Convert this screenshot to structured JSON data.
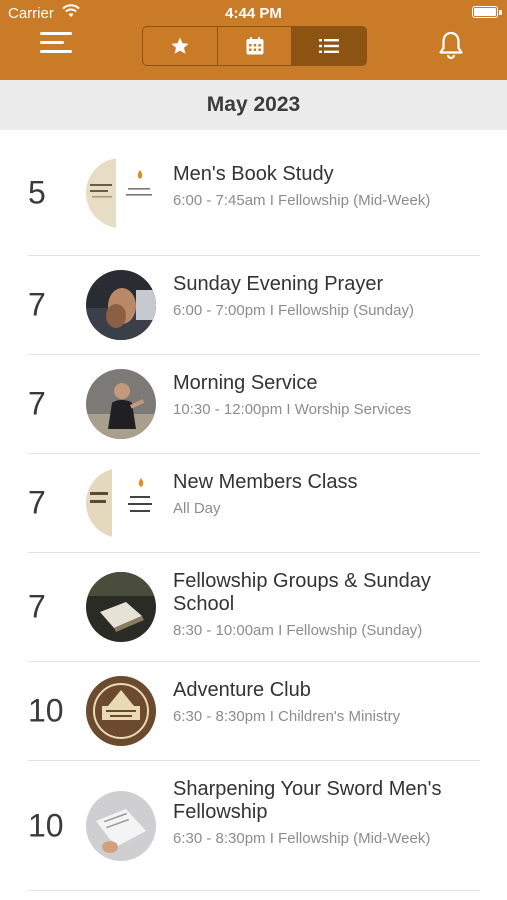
{
  "status_bar": {
    "carrier": "Carrier",
    "time": "4:44 PM"
  },
  "header": {
    "tabs": [
      {
        "icon": "star-icon",
        "active": false
      },
      {
        "icon": "calendar-icon",
        "active": false
      },
      {
        "icon": "list-icon",
        "active": true
      }
    ],
    "accent_color": "#c97b27"
  },
  "month": "May 2023",
  "events": [
    {
      "day": "5",
      "title": "Men's Book Study",
      "meta": "6:00  -  7:45am  I  Fellowship (Mid-Week)",
      "thumb": "book-study-image"
    },
    {
      "day": "7",
      "title": "Sunday Evening Prayer",
      "meta": "6:00  -  7:00pm  I  Fellowship (Sunday)",
      "thumb": "praying-hands-image"
    },
    {
      "day": "7",
      "title": "Morning Service",
      "meta": "10:30  -  12:00pm  I  Worship Services",
      "thumb": "preacher-image"
    },
    {
      "day": "7",
      "title": "New Members Class",
      "meta": "All Day",
      "thumb": "new-members-image"
    },
    {
      "day": "7",
      "title": "Fellowship Groups & Sunday School",
      "meta": "8:30  -  10:00am  I  Fellowship (Sunday)",
      "thumb": "bible-study-image"
    },
    {
      "day": "10",
      "title": "Adventure Club",
      "meta": "6:30  -  8:30pm  I  Children's Ministry",
      "thumb": "adventure-club-logo"
    },
    {
      "day": "10",
      "title": "Sharpening Your Sword Men's Fellowship",
      "meta": "6:30  -  8:30pm  I  Fellowship (Mid-Week)",
      "thumb": "reading-bible-image"
    }
  ]
}
